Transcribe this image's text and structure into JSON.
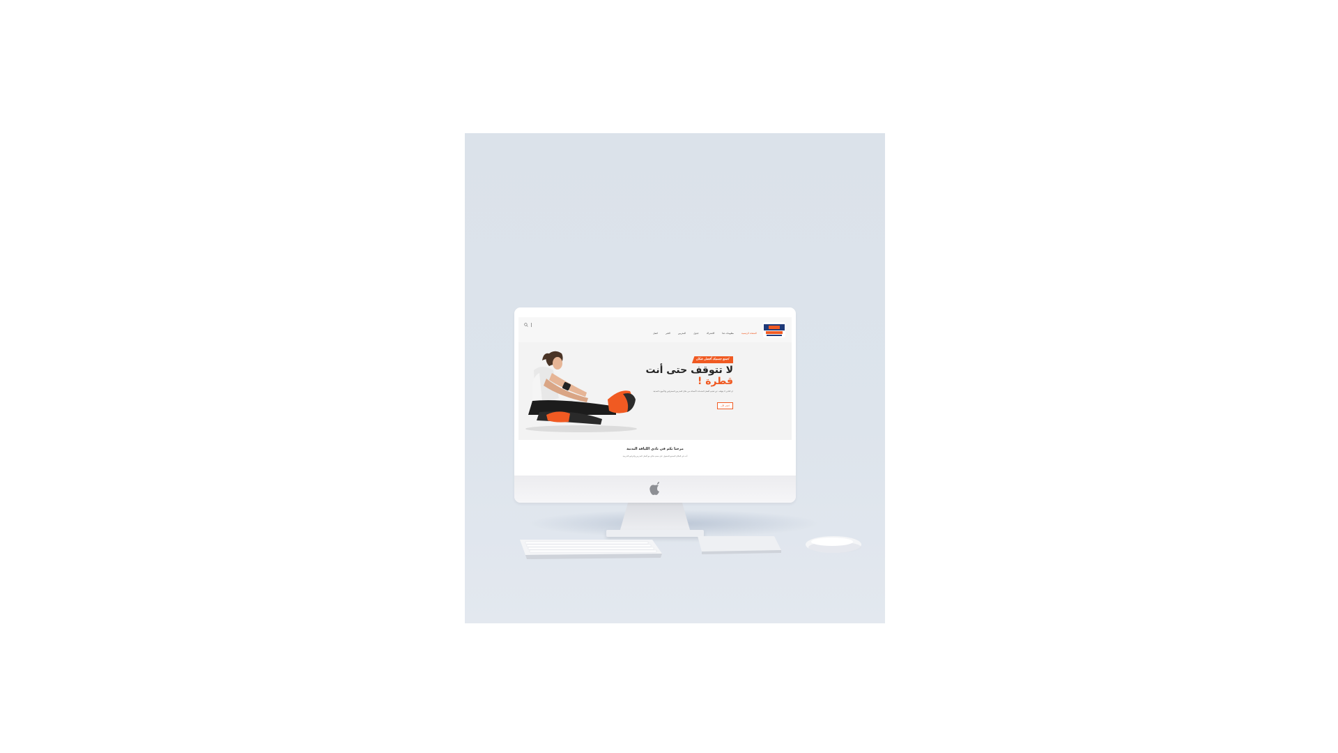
{
  "scene": {
    "background": "#dde4ec",
    "page_background": "#ffffff"
  },
  "site": {
    "brand_color": "#f05a22",
    "nav": {
      "items": [
        {
          "label": "الصفحة الرئيسية",
          "active": true
        },
        {
          "label": "معلومات عنا",
          "active": false
        },
        {
          "label": "الاشتراك",
          "active": false
        },
        {
          "label": "جدول",
          "active": false
        },
        {
          "label": "المدربين",
          "active": false
        },
        {
          "label": "الخبر",
          "active": false
        },
        {
          "label": "اتصل",
          "active": false
        }
      ],
      "search_icon": "search-icon"
    },
    "hero": {
      "tag": "اصنع جسمك أفضل شكل",
      "headline_line1": "لا تتوقف حتى أنت",
      "headline_line2": "قطرة !",
      "description": "ان النادي لا يتوقف عن تقديم أفضل الخدمات لأعضائه من خلال المدربين المحترفين والأجهزة الحديثة",
      "cta_label": "احجز الآن"
    },
    "welcome": {
      "title": "مرحبا بكم في نادي اللياقة البدنية",
      "text": "أنت في المكان الصحيح للحصول على جسم مثالي مع أفضل المدربين والبرامج التدريبية"
    }
  }
}
